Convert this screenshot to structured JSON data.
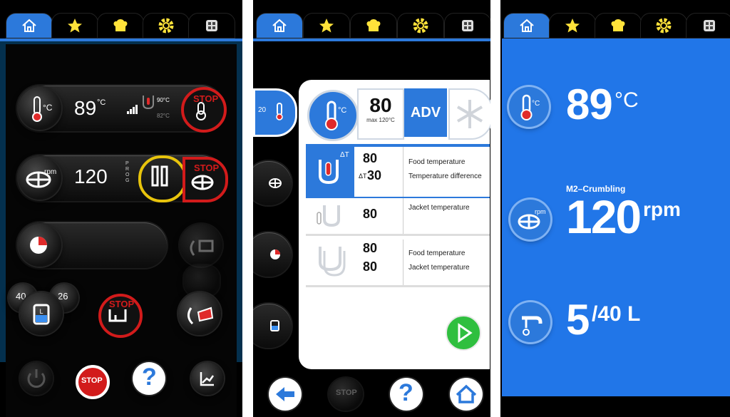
{
  "colors": {
    "accent": "#2c79db",
    "stop": "#d21b1b",
    "go": "#2fbf3f",
    "yellow": "#e8c40c"
  },
  "tab_icons": [
    "home-icon",
    "star-icon",
    "chef-hat-icon",
    "gear-icon",
    "grid-icon"
  ],
  "panel1": {
    "temp": {
      "value": "89",
      "unit": "°C",
      "target_ring": "90°C",
      "target_low": "82°C",
      "icon_unit": "°C"
    },
    "mixer": {
      "icon_unit": "rpm",
      "value": "120",
      "prog": "P R O G"
    },
    "stop": "STOP",
    "volume": {
      "left": "40",
      "right": "26"
    },
    "bottom": {
      "stop": "STOP",
      "help": "?"
    }
  },
  "panel2": {
    "side_temp": "20",
    "temp_icon_unit": "°C",
    "setpoint": {
      "value": "80",
      "max": "max 120°C"
    },
    "adv": "ADV",
    "rows": [
      {
        "v1": "80",
        "v2": "30",
        "delta": "ΔT",
        "d_label": "ΔT",
        "l1": "Food temperature",
        "l2": "Temperature difference"
      },
      {
        "v1": "80",
        "l1": "Jacket temperature"
      },
      {
        "v1": "80",
        "v2": "80",
        "l1": "Food temperature",
        "l2": "Jacket temperature"
      }
    ],
    "bottom": {
      "stop": "STOP",
      "help": "?"
    }
  },
  "panel3": {
    "temp": {
      "value": "89",
      "unit": "°C",
      "icon_unit": "°C"
    },
    "mix": {
      "label": "M2–Crumbling",
      "value": "120",
      "unit": "rpm",
      "icon_unit": "rpm"
    },
    "water": {
      "value": "5",
      "total": "/40 L"
    }
  }
}
